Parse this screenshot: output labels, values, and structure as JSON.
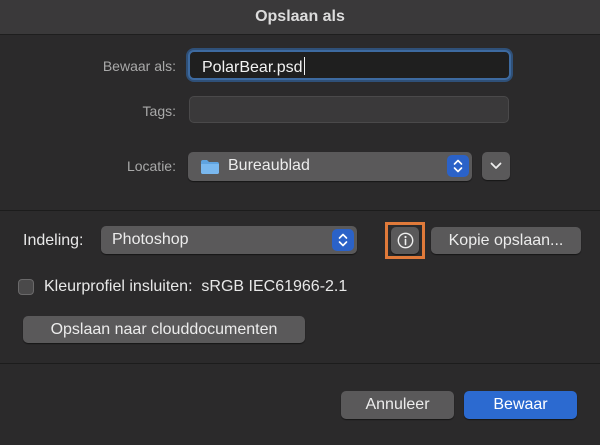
{
  "window": {
    "title": "Opslaan als"
  },
  "save_as": {
    "label": "Bewaar als:",
    "value": "PolarBear.psd"
  },
  "tags": {
    "label": "Tags:",
    "value": ""
  },
  "location": {
    "label": "Locatie:",
    "value": "Bureaublad",
    "icon": "folder-icon"
  },
  "format": {
    "label": "Indeling:",
    "value": "Photoshop"
  },
  "buttons": {
    "info_icon": "info-icon",
    "save_copy": "Kopie opslaan...",
    "cloud": "Opslaan naar clouddocumenten",
    "cancel": "Annuleer",
    "save": "Bewaar"
  },
  "color_profile": {
    "label": "Kleurprofiel insluiten:  sRGB IEC61966-2.1",
    "checked": false
  },
  "colors": {
    "accent": "#2c6ad0",
    "highlight": "#e07a3a"
  }
}
